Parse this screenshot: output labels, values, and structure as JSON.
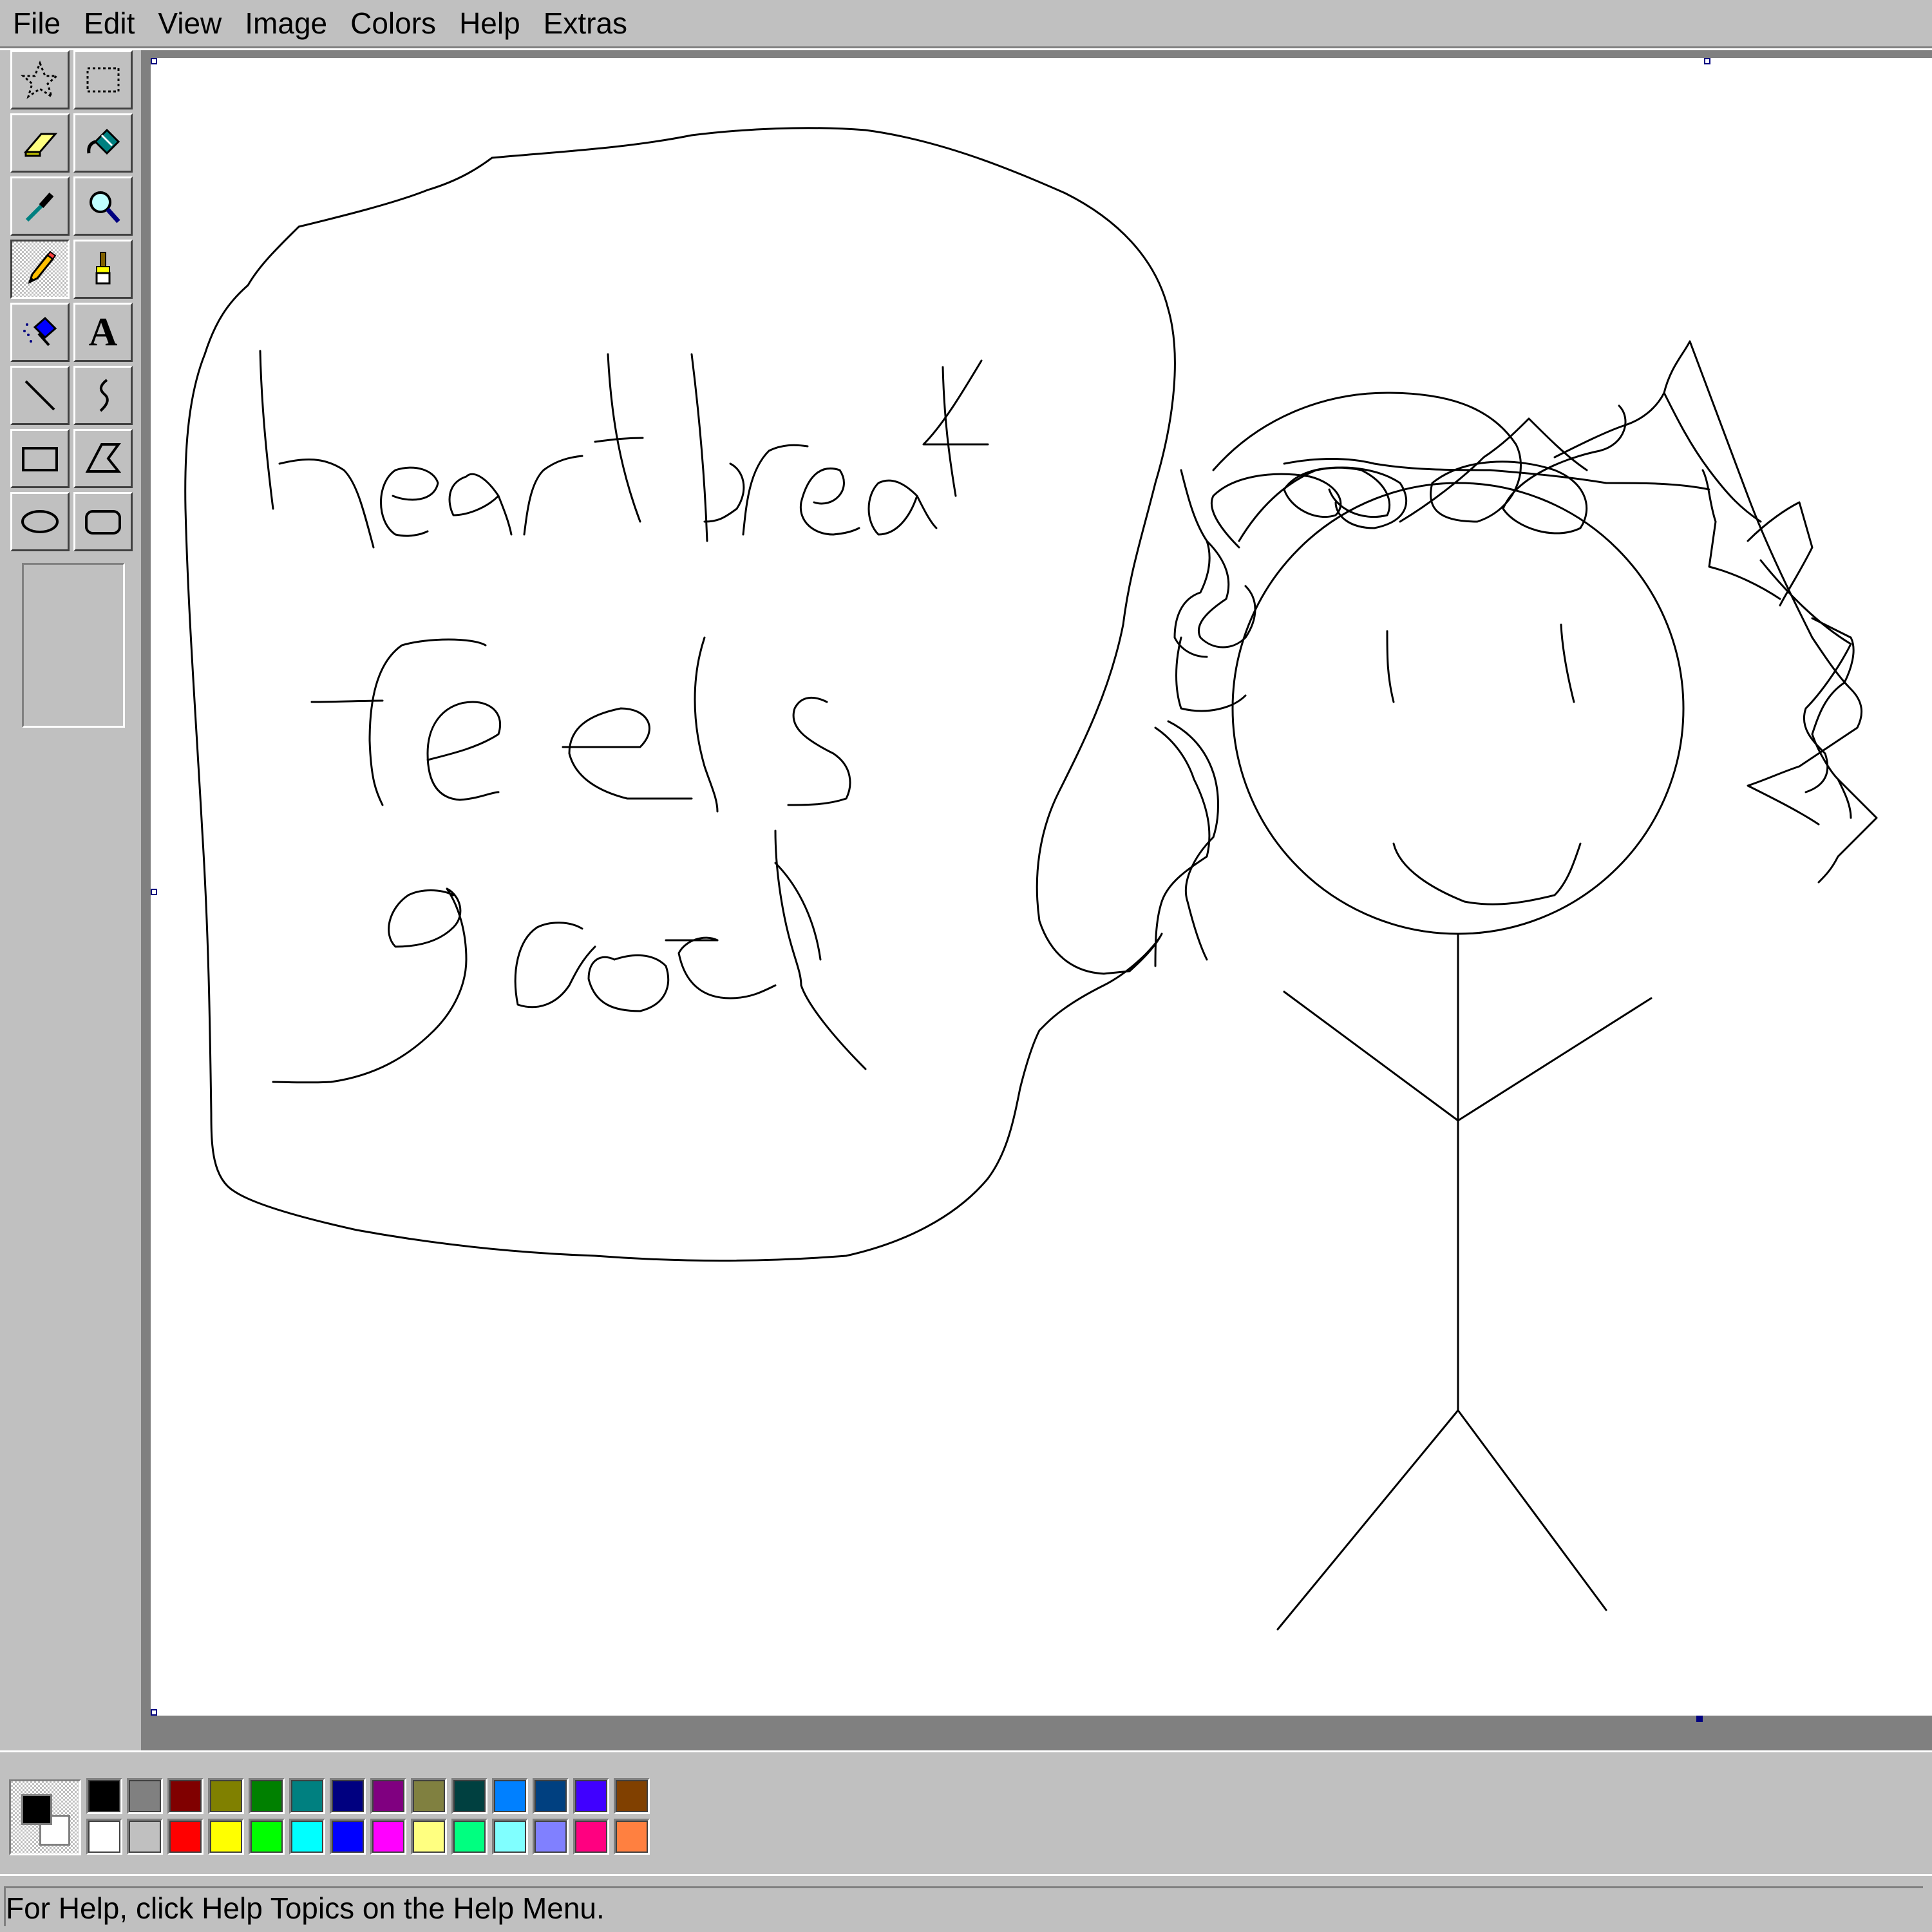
{
  "menu": {
    "items": [
      "File",
      "Edit",
      "View",
      "Image",
      "Colors",
      "Help",
      "Extras"
    ]
  },
  "tools": [
    {
      "name": "free-form-select-tool",
      "icon": "star-select-icon",
      "active": false
    },
    {
      "name": "select-tool",
      "icon": "dashed-rectangle-icon",
      "active": false
    },
    {
      "name": "eraser-tool",
      "icon": "eraser-icon",
      "active": false
    },
    {
      "name": "fill-tool",
      "icon": "paint-bucket-icon",
      "active": false
    },
    {
      "name": "pick-color-tool",
      "icon": "eyedropper-icon",
      "active": false
    },
    {
      "name": "magnifier-tool",
      "icon": "magnifier-icon",
      "active": false
    },
    {
      "name": "pencil-tool",
      "icon": "pencil-icon",
      "active": true
    },
    {
      "name": "brush-tool",
      "icon": "brush-icon",
      "active": false
    },
    {
      "name": "airbrush-tool",
      "icon": "airbrush-icon",
      "active": false
    },
    {
      "name": "text-tool",
      "icon": "text-icon",
      "active": false
    },
    {
      "name": "line-tool",
      "icon": "line-icon",
      "active": false
    },
    {
      "name": "curve-tool",
      "icon": "curve-icon",
      "active": false
    },
    {
      "name": "rectangle-tool",
      "icon": "rectangle-icon",
      "active": false
    },
    {
      "name": "polygon-tool",
      "icon": "polygon-icon",
      "active": false
    },
    {
      "name": "ellipse-tool",
      "icon": "ellipse-icon",
      "active": false
    },
    {
      "name": "rounded-rectangle-tool",
      "icon": "rounded-rectangle-icon",
      "active": false
    }
  ],
  "text_tool_glyph": "A",
  "current_colors": {
    "foreground": "#000000",
    "background": "#ffffff"
  },
  "palette": {
    "top": [
      "#000000",
      "#808080",
      "#800000",
      "#808000",
      "#008000",
      "#008080",
      "#000080",
      "#800080",
      "#808040",
      "#004040",
      "#0080ff",
      "#004080",
      "#4000ff",
      "#804000"
    ],
    "bottom": [
      "#ffffff",
      "#c0c0c0",
      "#ff0000",
      "#ffff00",
      "#00ff00",
      "#00ffff",
      "#0000ff",
      "#ff00ff",
      "#ffff80",
      "#00ff80",
      "#80ffff",
      "#8080ff",
      "#ff0080",
      "#ff8040"
    ]
  },
  "status": {
    "text": "For Help, click Help Topics on the Help Menu."
  }
}
